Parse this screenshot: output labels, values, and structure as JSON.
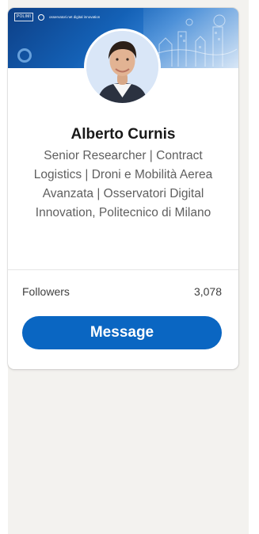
{
  "profile": {
    "name": "Alberto Curnis",
    "headline": "Senior Researcher | Contract Logistics | Droni e Mobilità Aerea Avanzata | Osservatori Digital Innovation, Politecnico di Milano",
    "followers_label": "Followers",
    "followers_count": "3,078",
    "message_label": "Message"
  },
  "banner": {
    "logo_left_text": "POLIMI",
    "logo_brand_text": "osservatori.net digital innovation"
  },
  "colors": {
    "accent": "#0a66c2",
    "name_text": "#191919",
    "secondary_text": "#5f5f5f",
    "page_bg": "#f3f2ef"
  },
  "icons": {
    "banner_logo_icon": "osservatori-logo-icon",
    "banner_lens_icon": "lens-ring-icon",
    "avatar": "profile-photo"
  }
}
